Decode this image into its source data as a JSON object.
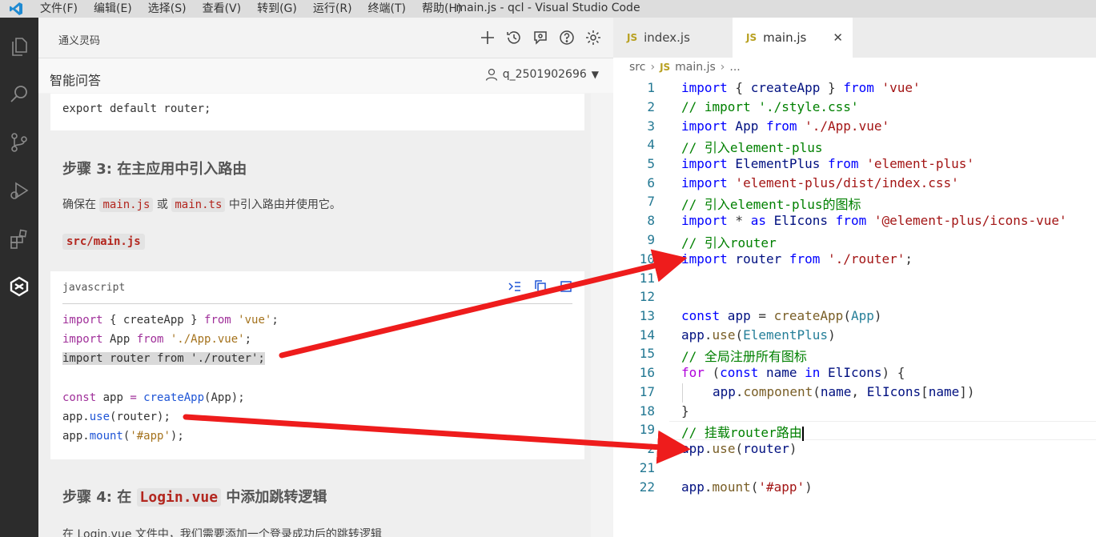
{
  "titlebar": {
    "menu": [
      "文件(F)",
      "编辑(E)",
      "选择(S)",
      "查看(V)",
      "转到(G)",
      "运行(R)",
      "终端(T)",
      "帮助(H)"
    ],
    "window_title": "main.js - qcl - Visual Studio Code"
  },
  "activitybar": {
    "icons": [
      "explorer-icon",
      "search-icon",
      "source-control-icon",
      "run-debug-icon",
      "extensions-icon",
      "tongyi-lingma-icon"
    ]
  },
  "panel": {
    "title": "通义灵码",
    "tab": "智能问答",
    "user": "q_2501902696",
    "top_code": "export default router;",
    "step3_heading": "步骤 3: 在主应用中引入路由",
    "step3_para_before": "确保在",
    "step3_code1": "main.js",
    "step3_para_mid": "或",
    "step3_code2": "main.ts",
    "step3_para_after": "中引入路由并使用它。",
    "filepath": "src/main.js",
    "code_lang": "javascript",
    "code": {
      "l1_kw": "import",
      "l1_mid": " { createApp } ",
      "l1_kw2": "from",
      "l1_str": " 'vue'",
      "l1_end": ";",
      "l2_kw": "import",
      "l2_mid": " App ",
      "l2_kw2": "from",
      "l2_str": " './App.vue'",
      "l2_end": ";",
      "l3": "import router from './router';",
      "l4_kw": "const",
      "l4_mid": " app ",
      "l4_eq": "=",
      "l4_fn": " createApp",
      "l4_end": "(App);",
      "l5_a": "app.",
      "l5_fn": "use",
      "l5_end": "(router);",
      "l6_a": "app.",
      "l6_fn": "mount",
      "l6_p": "(",
      "l6_str": "'#app'",
      "l6_end": ");"
    },
    "step4_heading_before": "步骤 4: 在",
    "step4_code": "Login.vue",
    "step4_heading_after": "中添加跳转逻辑",
    "step4_para": "在 Login.vue 文件中，我们需要添加一个登录成功后的跳转逻辑"
  },
  "editor": {
    "tabs": [
      {
        "label": "index.js",
        "badge": "JS"
      },
      {
        "label": "main.js",
        "badge": "JS",
        "close": "✕"
      }
    ],
    "breadcrumb": {
      "folder": "src",
      "badge": "JS",
      "file": "main.js",
      "more": "..."
    },
    "line_numbers": [
      "1",
      "2",
      "3",
      "4",
      "5",
      "6",
      "7",
      "8",
      "9",
      "10",
      "11",
      "12",
      "13",
      "14",
      "15",
      "16",
      "17",
      "18",
      "19",
      "2",
      "21",
      "22"
    ],
    "lines": {
      "l1": {
        "kw": "import",
        "a": " { ",
        "v": "createApp",
        "b": " } ",
        "kw2": "from",
        "s": " 'vue'"
      },
      "l2": "// import './style.css'",
      "l3": {
        "kw": "import",
        "a": " App ",
        "kw2": "from",
        "s": " './App.vue'"
      },
      "l4": "// 引入element-plus",
      "l5": {
        "kw": "import",
        "a": " ElementPlus ",
        "kw2": "from",
        "s": " 'element-plus'"
      },
      "l6": {
        "kw": "import",
        "s": " 'element-plus/dist/index.css'"
      },
      "l7": "// 引入element-plus的图标",
      "l8": {
        "kw": "import",
        "a": " * ",
        "kw2": "as",
        "b": " ElIcons ",
        "kw3": "from",
        "s": " '@element-plus/icons-vue'"
      },
      "l9": "// 引入router",
      "l10": {
        "kw": "import",
        "a": " router ",
        "kw2": "from",
        "s": " './router'",
        "end": ";"
      },
      "l13": {
        "kw": "const",
        "v": " app",
        "a": " = ",
        "f": "createApp",
        "b": "(",
        "v2": "App",
        "c": ")"
      },
      "l14": {
        "v": "app",
        "a": ".",
        "f": "use",
        "b": "(",
        "v2": "ElementPlus",
        "c": ")"
      },
      "l15": "// 全局注册所有图标",
      "l16": {
        "kw": "for",
        "a": " (",
        "kw2": "const",
        "v": " name",
        "kw3": " in",
        "v2": " ElIcons",
        "b": ") {"
      },
      "l17": {
        "v": "app",
        "a": ".",
        "f": "component",
        "b": "(",
        "v2": "name",
        "c": ", ",
        "v3": "ElIcons",
        "d": "[",
        "v4": "name",
        "e": "])"
      },
      "l18": "}",
      "l19": "// 挂载router路由",
      "l20": {
        "v": "app",
        "a": ".",
        "f": "use",
        "b": "(",
        "v2": "router",
        "c": ")"
      },
      "l22": {
        "v": "app",
        "a": ".",
        "f": "mount",
        "b": "(",
        "s": "'#app'",
        "c": ")"
      }
    }
  },
  "colors": {
    "arrow": "#ee1c1c",
    "activitybar": "#2c2c2c",
    "vscode_blue": "#1f8ad2"
  }
}
